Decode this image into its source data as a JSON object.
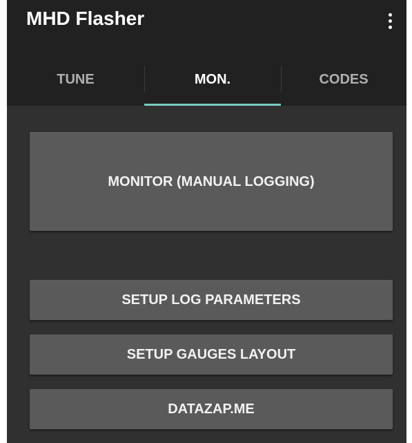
{
  "app": {
    "title": "MHD Flasher",
    "menu_icon": "more-vert-icon"
  },
  "tabs": [
    {
      "label": "TUNE",
      "active": false
    },
    {
      "label": "MON.",
      "active": true
    },
    {
      "label": "CODES",
      "active": false
    }
  ],
  "buttons": {
    "monitor": "MONITOR (MANUAL LOGGING)",
    "setup_log": "SETUP LOG PARAMETERS",
    "setup_gauges": "SETUP GAUGES LAYOUT",
    "datazap": "DATAZAP.ME"
  },
  "colors": {
    "appbar_background": "#212121",
    "content_background": "#303030",
    "button_background": "#5a5a5a",
    "tab_indicator": "#79ccc1"
  }
}
